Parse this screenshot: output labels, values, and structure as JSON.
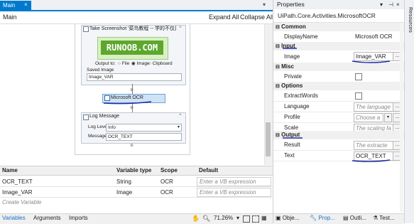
{
  "tabs": {
    "main_label": "Main",
    "close_glyph": "×"
  },
  "document": {
    "breadcrumb": "Main",
    "expand_all": "Expand All",
    "collapse_all": "Collapse All"
  },
  "workflow": {
    "take_screenshot": {
      "title": "Take Screenshot '菜鸟教程 -- 学的不仅是技术，更",
      "logo_text": "RUNOOB.COM",
      "output_label": "Output to:",
      "output_options": [
        "File",
        "Image",
        "Clipboard"
      ],
      "output_selected": "Image",
      "saved_image_label": "Saved Image",
      "saved_image_value": "Image_VAR"
    },
    "microsoft_ocr": {
      "title": "Microsoft OCR"
    },
    "log_message": {
      "title": "Log Message",
      "level_label": "Log Level",
      "level_value": "Info",
      "message_label": "Message",
      "message_value": "OCR_TEXT"
    }
  },
  "variables": {
    "headers": [
      "Name",
      "Variable type",
      "Scope",
      "Default"
    ],
    "rows": [
      {
        "name": "OCR_TEXT",
        "type": "String",
        "scope": "OCR",
        "default_placeholder": "Enter a VB expression"
      },
      {
        "name": "Image_VAR",
        "type": "Image",
        "scope": "OCR",
        "default_placeholder": "Enter a VB expression"
      }
    ],
    "create_label": "Create Variable"
  },
  "statusbar": {
    "variables": "Variables",
    "arguments": "Arguments",
    "imports": "Imports",
    "zoom": "71.26%"
  },
  "properties": {
    "title": "Properties",
    "activity_type": "UiPath.Core.Activities.MicrosoftOCR",
    "categories": {
      "common": "Common",
      "input": "Input",
      "misc": "Misc",
      "options": "Options",
      "output": "Output"
    },
    "display_name_label": "DisplayName",
    "display_name_value": "Microsoft OCR",
    "image_label": "Image",
    "image_value": "Image_VAR",
    "private_label": "Private",
    "extract_words_label": "ExtractWords",
    "language_label": "Language",
    "language_placeholder": "The language",
    "profile_label": "Profile",
    "profile_placeholder": "Choose a",
    "scale_label": "Scale",
    "scale_placeholder": "The scaling fa",
    "result_label": "Result",
    "result_placeholder": "The extracte",
    "text_label": "Text",
    "text_value": "OCR_TEXT",
    "ellipsis": "...",
    "bottom_tabs": [
      "Obje...",
      "Prop...",
      "Outli...",
      "Test..."
    ]
  },
  "side_panel": {
    "label": "Resources"
  },
  "colors": {
    "accent": "#007acc",
    "annotation": "#1f2aa8",
    "logo_green": "#5ea72f",
    "selected_activity": "#cfe3f6"
  }
}
